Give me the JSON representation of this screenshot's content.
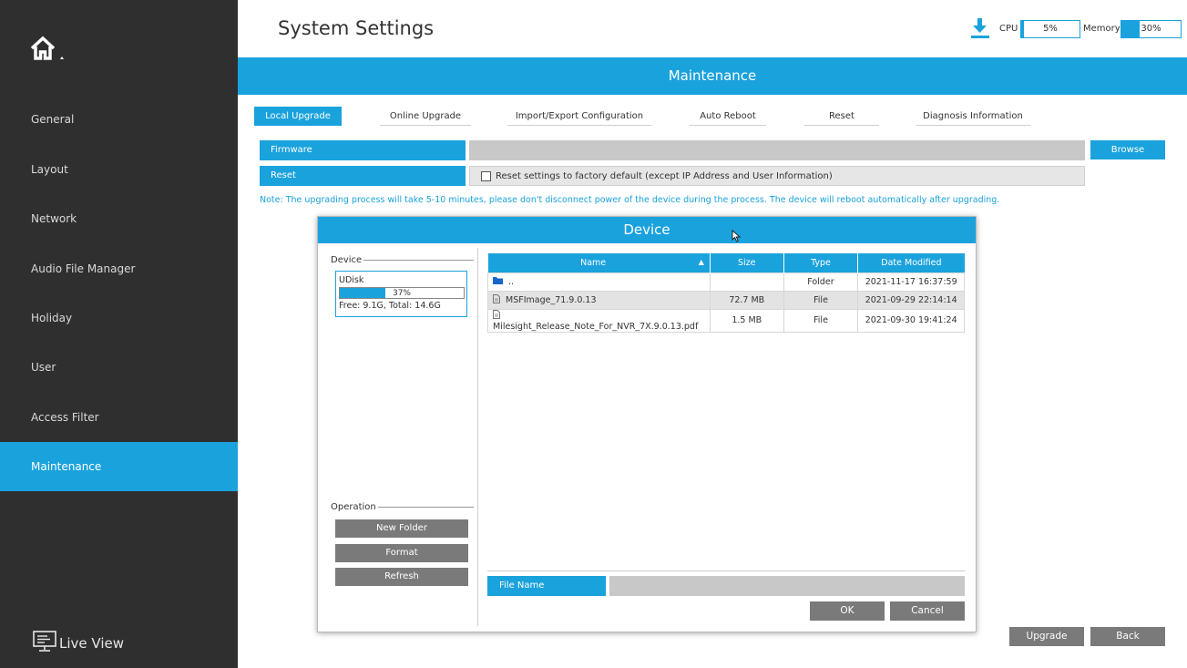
{
  "sidebar": {
    "items": [
      {
        "label": "General"
      },
      {
        "label": "Layout"
      },
      {
        "label": "Network"
      },
      {
        "label": "Audio File Manager"
      },
      {
        "label": "Holiday"
      },
      {
        "label": "User"
      },
      {
        "label": "Access Filter"
      },
      {
        "label": "Maintenance",
        "active": true
      }
    ],
    "live_view_label": "Live View"
  },
  "header": {
    "title": "System Settings",
    "cpu_label": "CPU",
    "cpu_value": "5%",
    "cpu_percent": 5,
    "memory_label": "Memory",
    "memory_value": "30%",
    "memory_percent": 30
  },
  "section_title": "Maintenance",
  "tabs": [
    {
      "label": "Local Upgrade",
      "active": true
    },
    {
      "label": "Online Upgrade"
    },
    {
      "label": "Import/Export Configuration"
    },
    {
      "label": "Auto Reboot"
    },
    {
      "label": "Reset"
    },
    {
      "label": "Diagnosis Information"
    }
  ],
  "form": {
    "firmware_label": "Firmware",
    "firmware_value": "",
    "browse_label": "Browse",
    "reset_label": "Reset",
    "reset_checkbox_text": "Reset settings to factory default (except IP Address and User Information)",
    "reset_checked": false
  },
  "note": "Note: The upgrading process will take 5-10 minutes, please don't disconnect power of the device during the process. The device will reboot automatically after upgrading.",
  "dialog": {
    "title": "Device",
    "device_group_label": "Device",
    "udisk": {
      "name": "UDisk",
      "usage_text": "37%",
      "usage_percent": 37,
      "capacity_text": "Free: 9.1G, Total: 14.6G"
    },
    "operation_group_label": "Operation",
    "operations": [
      "New Folder",
      "Format",
      "Refresh"
    ],
    "table": {
      "headers": {
        "name": "Name",
        "size": "Size",
        "type": "Type",
        "date": "Date Modified"
      },
      "rows": [
        {
          "icon": "folder-icon",
          "name": "..",
          "size": "",
          "type": "Folder",
          "date": "2021-11-17 16:37:59"
        },
        {
          "icon": "file-icon",
          "name": "MSFImage_71.9.0.13",
          "size": "72.7 MB",
          "type": "File",
          "date": "2021-09-29 22:14:14",
          "selected": true
        },
        {
          "icon": "file-icon",
          "name": "Milesight_Release_Note_For_NVR_7X.9.0.13.pdf",
          "size": "1.5 MB",
          "type": "File",
          "date": "2021-09-30 19:41:24"
        }
      ]
    },
    "file_name_label": "File Name",
    "file_name_value": "",
    "ok_label": "OK",
    "cancel_label": "Cancel"
  },
  "footer": {
    "upgrade_label": "Upgrade",
    "back_label": "Back"
  },
  "colors": {
    "accent": "#1aa2dd",
    "sidebar_bg": "#2f2f2f",
    "gray_button": "#7a7a7a"
  }
}
